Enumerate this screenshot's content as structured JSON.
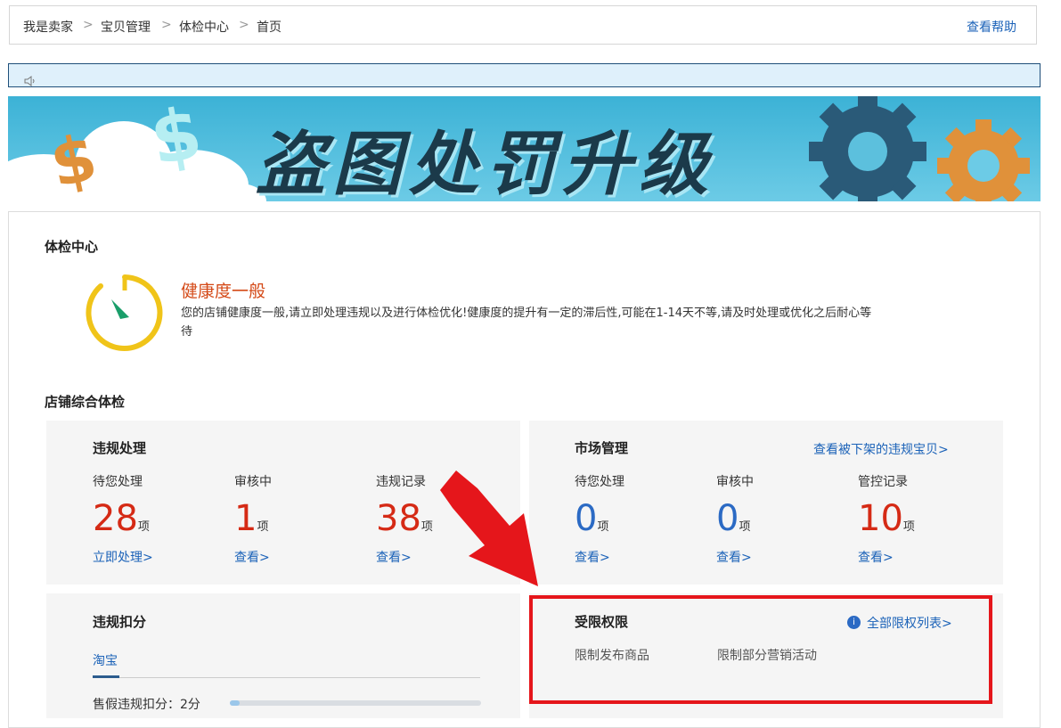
{
  "breadcrumb": {
    "items": [
      "我是卖家",
      "宝贝管理",
      "体检中心",
      "首页"
    ],
    "separator": ">",
    "help": "查看帮助"
  },
  "notice": {
    "icon": "speaker-icon"
  },
  "banner": {
    "title": "盗图处罚升级"
  },
  "checkup": {
    "title": "体检中心",
    "health": {
      "title": "健康度一般",
      "line1": "您的店铺健康度一般,请立即处理违规以及进行体检优化!健康度的提升有一定的滞后性,可能在1-14天不等,请及时处理或优化之后耐心等",
      "line2": "待"
    }
  },
  "comprehensive": {
    "title": "店铺综合体检",
    "violations": {
      "title": "违规处理",
      "stats": [
        {
          "label": "待您处理",
          "value": "28",
          "unit": "项",
          "link": "立即处理>"
        },
        {
          "label": "审核中",
          "value": "1",
          "unit": "项",
          "link": "查看>"
        },
        {
          "label": "违规记录",
          "value": "38",
          "unit": "项",
          "link": "查看>"
        }
      ]
    },
    "market": {
      "title": "市场管理",
      "link": "查看被下架的违规宝贝>",
      "stats": [
        {
          "label": "待您处理",
          "value": "0",
          "unit": "项",
          "link": "查看>"
        },
        {
          "label": "审核中",
          "value": "0",
          "unit": "项",
          "link": "查看>"
        },
        {
          "label": "管控记录",
          "value": "10",
          "unit": "项",
          "link": "查看>"
        }
      ]
    },
    "deduction": {
      "title": "违规扣分",
      "tab": "淘宝",
      "row_label": "售假违规扣分：2分",
      "bar_fraction": 0.04
    },
    "restricted": {
      "title": "受限权限",
      "link": "全部限权列表>",
      "items": [
        "限制发布商品",
        "限制部分营销活动"
      ]
    }
  },
  "colors": {
    "accent_blue": "#1b62b8",
    "alert_red": "#d52a15",
    "highlight_box": "#e5161b",
    "health_orange": "#d44a18",
    "gauge_yellow": "#f0c419"
  }
}
